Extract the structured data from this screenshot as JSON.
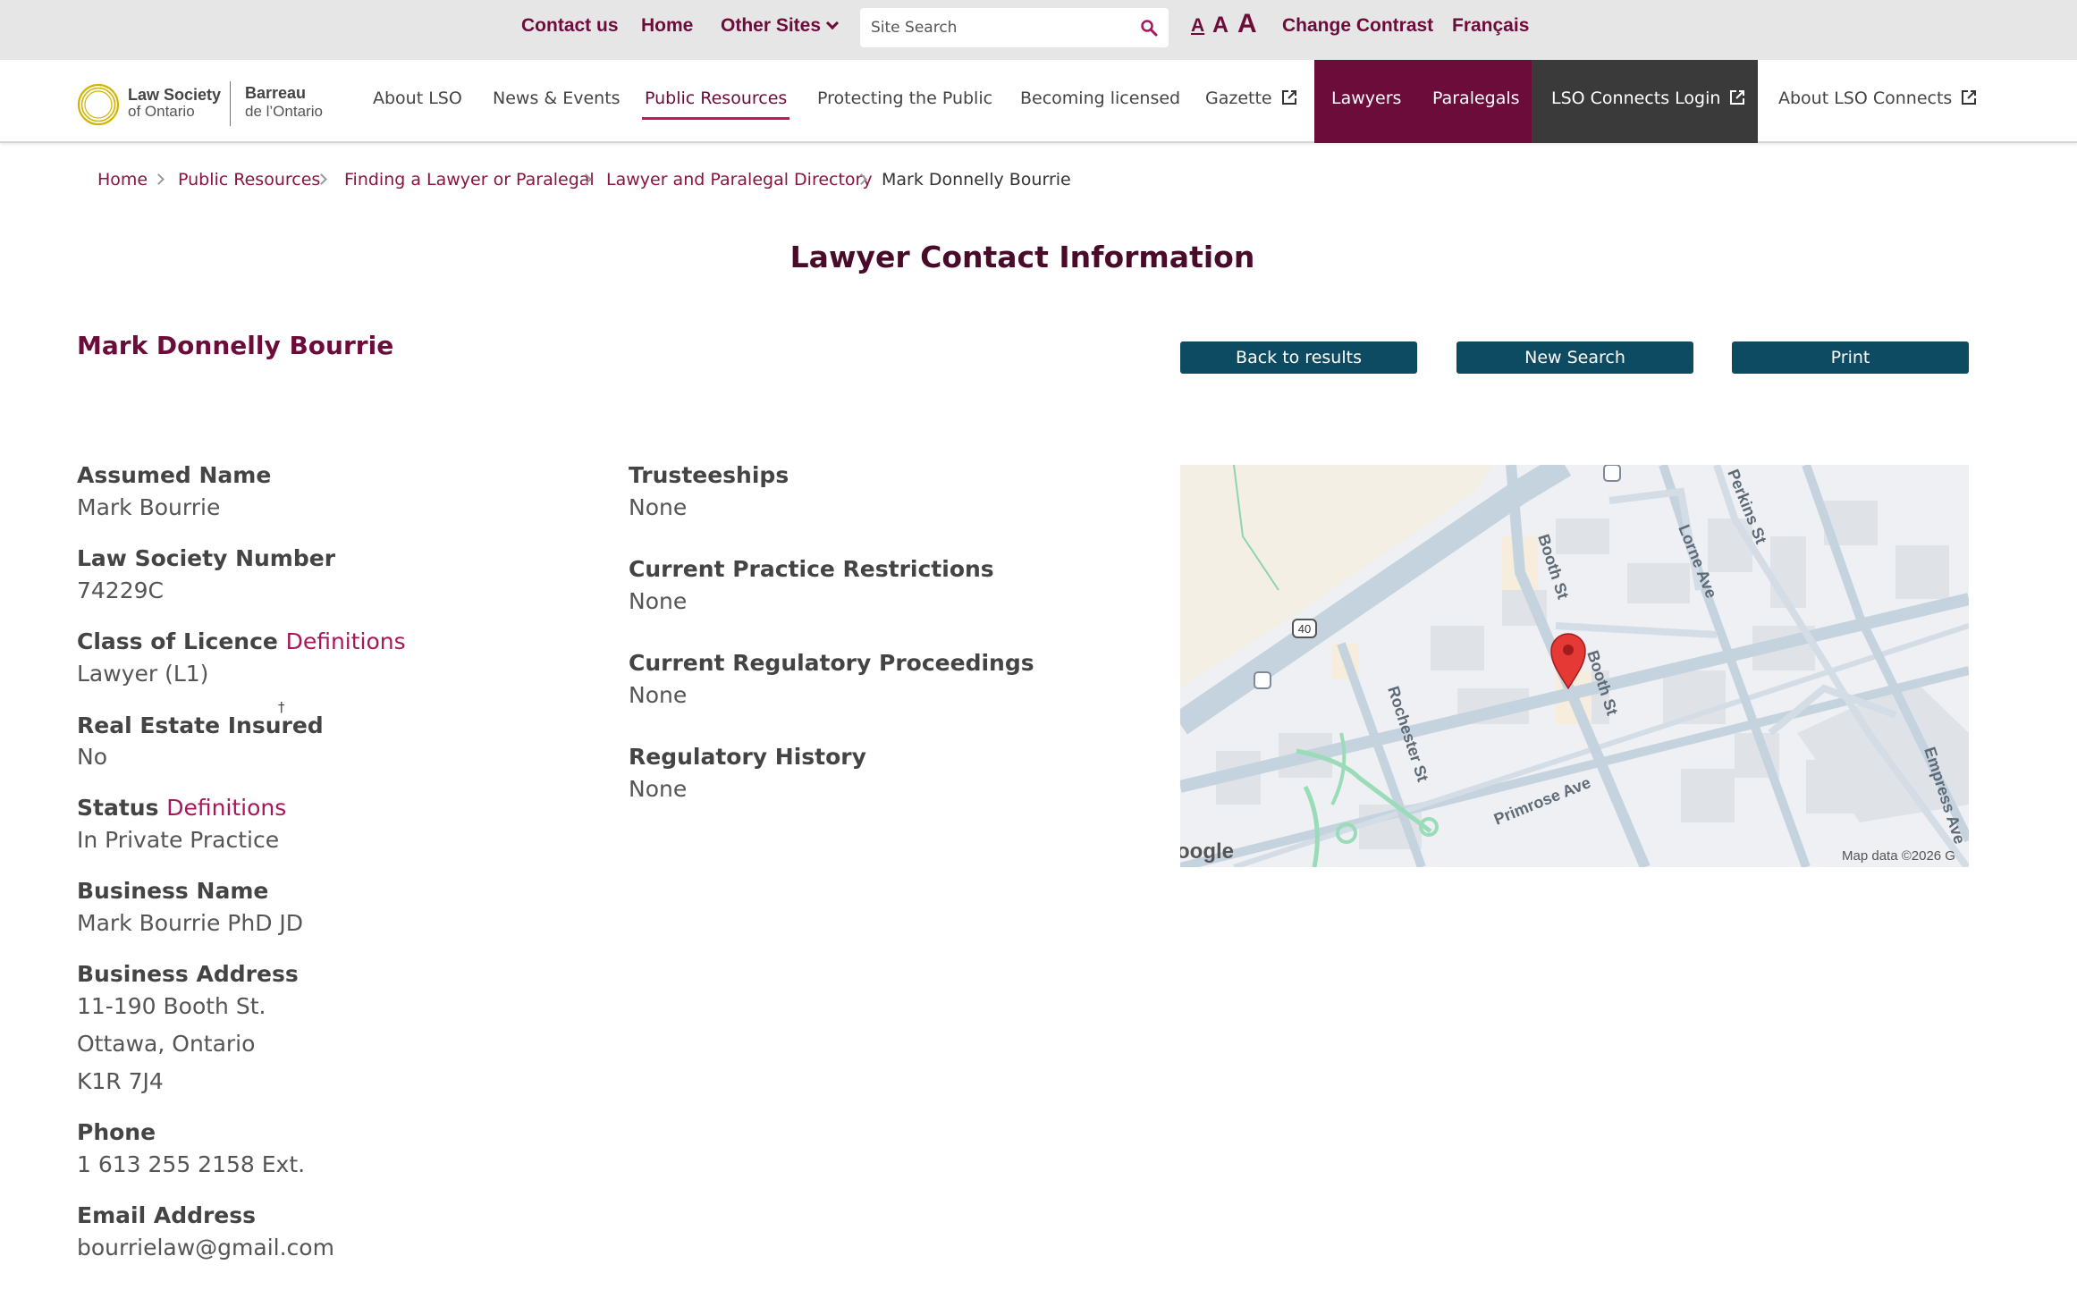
{
  "utility": {
    "contact": "Contact us",
    "home": "Home",
    "other_sites": "Other Sites",
    "search_placeholder": "Site Search",
    "font_small": "A",
    "font_medium": "A",
    "font_large": "A",
    "change_contrast": "Change Contrast",
    "francais": "Français"
  },
  "logo": {
    "line1": "Law Society",
    "line2": "of Ontario",
    "line3": "Barreau",
    "line4": "de l’Ontario"
  },
  "nav": {
    "about": "About LSO",
    "news": "News & Events",
    "public": "Public Resources",
    "protecting": "Protecting the Public",
    "licensed": "Becoming licensed",
    "gazette": "Gazette",
    "lawyers": "Lawyers",
    "paralegals": "Paralegals",
    "connects_login": "LSO Connects Login",
    "about_connects": "About LSO Connects",
    "active": "Public Resources"
  },
  "breadcrumb": {
    "home": "Home",
    "public": "Public Resources",
    "finding": "Finding a Lawyer or Paralegal",
    "directory": "Lawyer and Paralegal Directory",
    "current": "Mark Donnelly Bourrie"
  },
  "page": {
    "title": "Lawyer Contact Information",
    "name": "Mark Donnelly Bourrie",
    "back_button": "Back to results",
    "new_search_button": "New Search",
    "print_button": "Print"
  },
  "fields": {
    "assumed_name_label": "Assumed Name",
    "assumed_name": "Mark Bourrie",
    "number_label": "Law Society Number",
    "number": "74229C",
    "class_label": "Class of Licence",
    "definitions_link": "Definitions",
    "class": "Lawyer (L1)",
    "real_estate_label": "Real Estate Insured",
    "dagger": "†",
    "real_estate": "No",
    "status_label": "Status",
    "status": "In Private Practice",
    "business_name_label": "Business Name",
    "business_name": "Mark Bourrie PhD JD",
    "address_label": "Business Address",
    "address_line1": "11-190 Booth St.",
    "address_line2": "Ottawa, Ontario",
    "address_line3": "K1R 7J4",
    "phone_label": "Phone",
    "phone": "1 613 255 2158 Ext.",
    "email_label": "Email Address",
    "email": "bourrielaw@gmail.com",
    "trusteeships_label": "Trusteeships",
    "trusteeships": "None",
    "restrictions_label": "Current Practice Restrictions",
    "restrictions": "None",
    "proceedings_label": "Current Regulatory Proceedings",
    "proceedings": "None",
    "history_label": "Regulatory History",
    "history": "None"
  },
  "map": {
    "streets": {
      "booth1": "Booth St",
      "booth2": "Booth St",
      "lorne": "Lorne Ave",
      "perkins": "Perkins St",
      "rochester": "Rochester St",
      "primrose": "Primrose Ave",
      "empress": "Empress Ave"
    },
    "highway_shield": "40",
    "google_text": "oogle",
    "attribution": "Map data ©2026 G"
  },
  "colors": {
    "brand": "#6b0c3a",
    "button": "#0d4b63",
    "connects_bg": "#3a3a3a",
    "link": "#a8175a"
  }
}
